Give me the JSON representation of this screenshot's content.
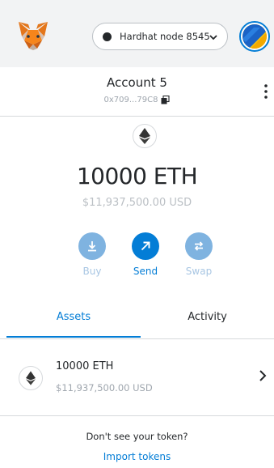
{
  "header": {
    "network": {
      "label": "Hardhat node 8545"
    }
  },
  "account": {
    "name": "Account 5",
    "address_short": "0x709...79C8"
  },
  "balance": {
    "primary": "10000 ETH",
    "secondary": "$11,937,500.00 USD"
  },
  "actions": [
    {
      "label": "Buy"
    },
    {
      "label": "Send"
    },
    {
      "label": "Swap"
    }
  ],
  "tabs": [
    {
      "label": "Assets",
      "active": true
    },
    {
      "label": "Activity",
      "active": false
    }
  ],
  "assets": [
    {
      "amount": "10000 ETH",
      "usd": "$11,937,500.00 USD"
    }
  ],
  "footer": {
    "question": "Don't see your token?",
    "import_label": "Import tokens"
  },
  "colors": {
    "accent": "#037dd6",
    "header_bg": "#f2f3f4",
    "muted_text": "#9fa6ae",
    "light_action": "#7fb3e0"
  }
}
